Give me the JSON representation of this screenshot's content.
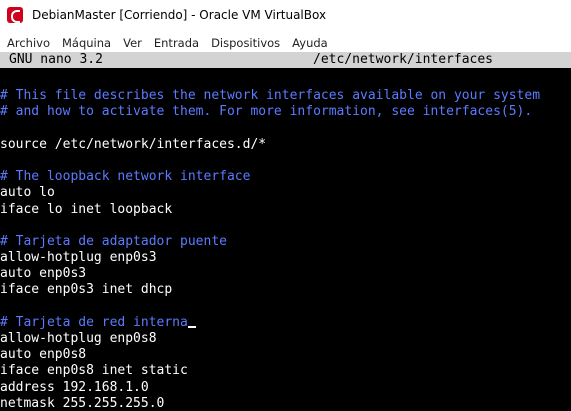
{
  "window": {
    "title": "DebianMaster [Corriendo] - Oracle VM VirtualBox"
  },
  "menu": {
    "items": [
      "Archivo",
      "Máquina",
      "Ver",
      "Entrada",
      "Dispositivos",
      "Ayuda"
    ]
  },
  "nano": {
    "version": "GNU nano 3.2",
    "filename": "/etc/network/interfaces"
  },
  "file_lines": [
    {
      "text": "",
      "kind": "blank"
    },
    {
      "text": "# This file describes the network interfaces available on your system",
      "kind": "comment"
    },
    {
      "text": "# and how to activate them. For more information, see interfaces(5).",
      "kind": "comment"
    },
    {
      "text": "",
      "kind": "blank"
    },
    {
      "text": "source /etc/network/interfaces.d/*",
      "kind": "code"
    },
    {
      "text": "",
      "kind": "blank"
    },
    {
      "text": "# The loopback network interface",
      "kind": "comment"
    },
    {
      "text": "auto lo",
      "kind": "code"
    },
    {
      "text": "iface lo inet loopback",
      "kind": "code"
    },
    {
      "text": "",
      "kind": "blank"
    },
    {
      "text": "# Tarjeta de adaptador puente",
      "kind": "comment"
    },
    {
      "text": "allow-hotplug enp0s3",
      "kind": "code"
    },
    {
      "text": "auto enp0s3",
      "kind": "code"
    },
    {
      "text": "iface enp0s3 inet dhcp",
      "kind": "code"
    },
    {
      "text": "",
      "kind": "blank"
    },
    {
      "text": "# Tarjeta de red interna",
      "kind": "comment"
    },
    {
      "text": "allow-hotplug enp0s8",
      "kind": "code"
    },
    {
      "text": "auto enp0s8",
      "kind": "code"
    },
    {
      "text": "iface enp0s8 inet static",
      "kind": "code"
    },
    {
      "text": "address 192.168.1.0",
      "kind": "code"
    },
    {
      "text": "netmask 255.255.255.0",
      "kind": "code"
    }
  ],
  "colors": {
    "comment": "#5b7bff",
    "code": "#ffffff",
    "terminal_bg": "#000000",
    "header_bg": "#d3d3d3"
  }
}
